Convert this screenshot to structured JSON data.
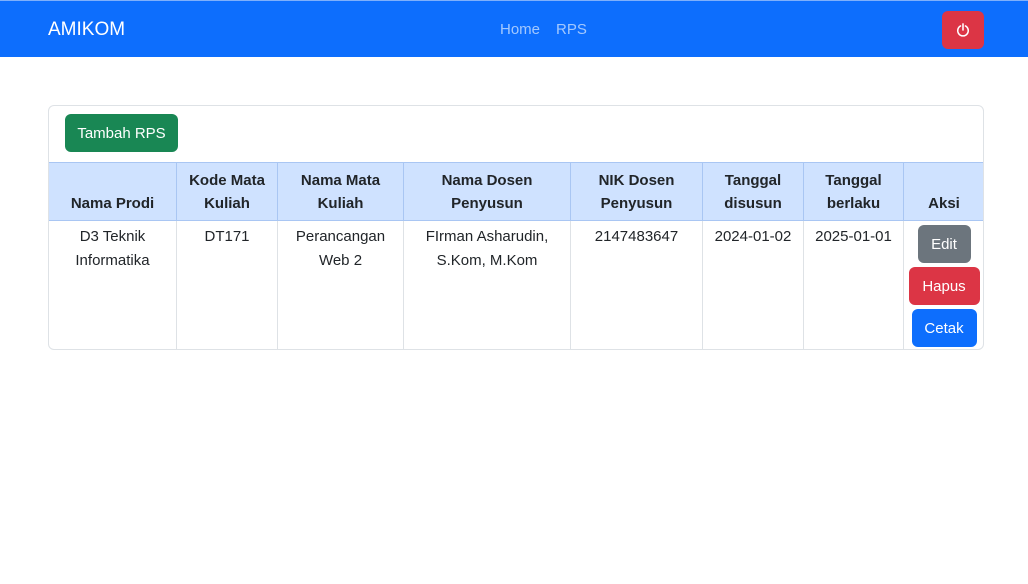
{
  "navbar": {
    "brand": "AMIKOM",
    "links": [
      "Home",
      "RPS"
    ],
    "power_icon": "power-icon",
    "colors": {
      "bg": "#0d6efd",
      "power": "#dc3545"
    }
  },
  "card": {
    "add_button": "Tambah RPS",
    "table": {
      "headers": [
        "Nama Prodi",
        "Kode Mata Kuliah",
        "Nama Mata Kuliah",
        "Nama Dosen Penyusun",
        "NIK Dosen Penyusun",
        "Tanggal disusun",
        "Tanggal berlaku",
        "Aksi"
      ],
      "rows": [
        {
          "cells": [
            "D3 Teknik Informatika",
            "DT171",
            "Perancangan Web 2",
            "FIrman Asharudin, S.Kom, M.Kom",
            "2147483647",
            "2024-01-02",
            "2025-01-01"
          ],
          "actions": [
            "Edit",
            "Hapus",
            "Cetak"
          ]
        }
      ]
    }
  }
}
